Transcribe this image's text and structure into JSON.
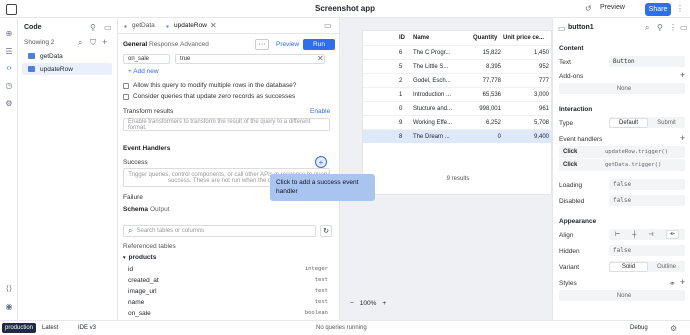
{
  "app": {
    "title": "Screenshot app",
    "preview": "Preview",
    "share": "Share"
  },
  "code_panel": {
    "title": "Code",
    "showing": "Showing 2",
    "queries": [
      "getData",
      "updateRow"
    ]
  },
  "editor": {
    "tabs": [
      "getData",
      "updateRow"
    ],
    "subtabs": [
      "General",
      "Response",
      "Advanced"
    ],
    "preview": "Preview",
    "run": "Run",
    "field_on_sale": "on_sale",
    "field_true": "true",
    "add_new": "+ Add new",
    "allow_modify": "Allow this query to modify multiple rows in the database?",
    "consider_update": "Consider queries that update zero records as successes",
    "transform_title": "Transform results",
    "enable": "Enable",
    "transform_placeholder": "Enable transformers to transform the result of the query to a different format.",
    "handlers_title": "Event Handlers",
    "success": "Success",
    "success_placeholder_1": "Trigger queries, control components, or call other APIs in response to query",
    "success_placeholder_2": "success. These are not run when the query is",
    "failure": "Failure",
    "schema_tabs": [
      "Schema",
      "Output"
    ],
    "search_placeholder": "Search tables or columns",
    "referenced": "Referenced tables",
    "table_name": "products",
    "columns": [
      {
        "name": "id",
        "type": "integer"
      },
      {
        "name": "created_at",
        "type": "text"
      },
      {
        "name": "image_url",
        "type": "text"
      },
      {
        "name": "name",
        "type": "text"
      },
      {
        "name": "on_sale",
        "type": "boolean"
      }
    ]
  },
  "tooltip": {
    "text": "Click to add a success event handler"
  },
  "table": {
    "headers": [
      "ID",
      "Name",
      "Quantity",
      "Unit price ce..."
    ],
    "rows": [
      [
        "6",
        "The C Progr...",
        "15,822",
        "1,450"
      ],
      [
        "5",
        "The Little S...",
        "8,395",
        "952"
      ],
      [
        "2",
        "Godel, Esch...",
        "77,778",
        "777"
      ],
      [
        "1",
        "Introduction ...",
        "65,536",
        "3,000"
      ],
      [
        "0",
        "Stucture and...",
        "998,001",
        "961"
      ],
      [
        "9",
        "Working Effe...",
        "6,252",
        "5,708"
      ],
      [
        "8",
        "The Dream ...",
        "0",
        "9,400"
      ]
    ],
    "results": "9 results",
    "zoom": "100%"
  },
  "inspector": {
    "component": "button1",
    "content": "Content",
    "text_label": "Text",
    "text_value": "Button",
    "addons": "Add-ons",
    "none": "None",
    "interaction": "Interaction",
    "type_label": "Type",
    "type_default": "Default",
    "type_submit": "Submit",
    "event_handlers": "Event handlers",
    "handler_1_event": "Click",
    "handler_1_action": "updateRow.trigger()",
    "handler_2_event": "Click",
    "handler_2_action": "getData.trigger()",
    "loading": "Loading",
    "disabled": "Disabled",
    "false": "false",
    "appearance": "Appearance",
    "align": "Align",
    "hidden": "Hidden",
    "variant": "Variant",
    "variant_solid": "Solid",
    "variant_outline": "Outline",
    "styles": "Styles"
  },
  "bottombar": {
    "env": "production",
    "latest": "Latest",
    "ide": "IDE v3",
    "status": "No queries running",
    "debug": "Debug"
  },
  "colors": {
    "accent": "#2f6feb",
    "tooltip": "#a9c4ef",
    "selected_row": "#dde8fb"
  }
}
